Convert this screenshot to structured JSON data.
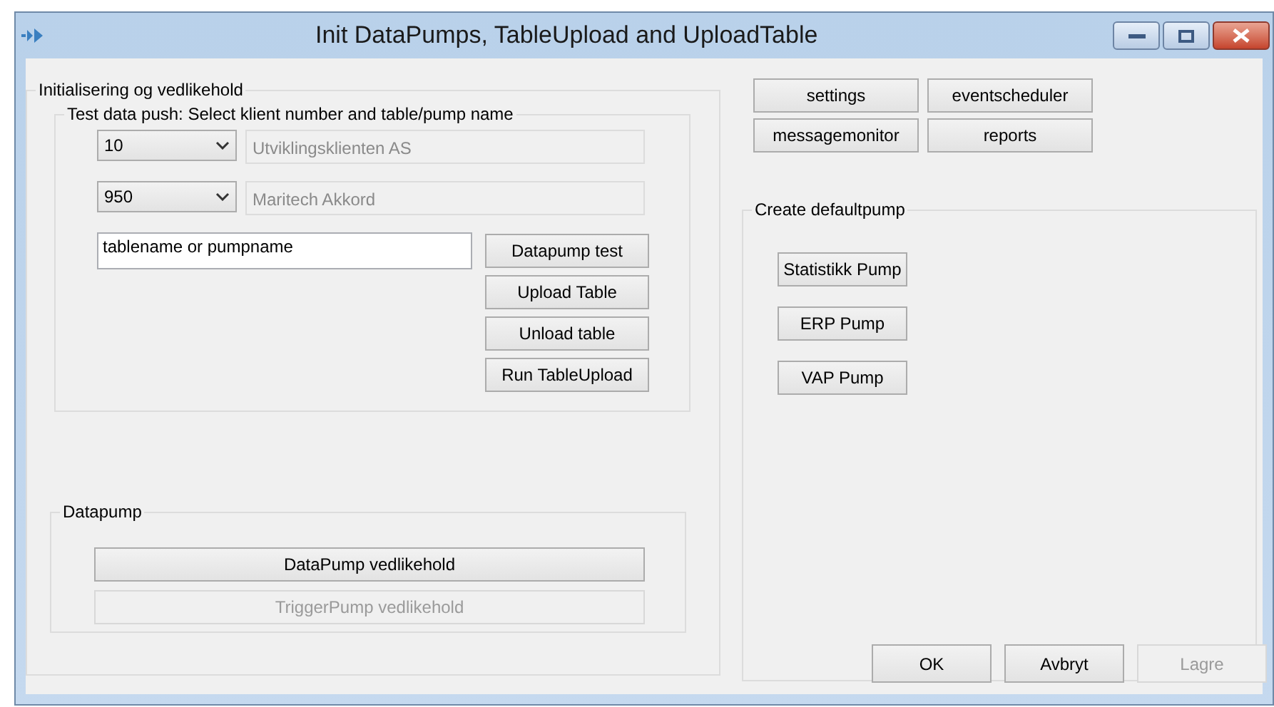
{
  "window": {
    "title": "Init DataPumps, TableUpload and UploadTable"
  },
  "init_group": {
    "title": "Initialisering og vedlikehold",
    "test_group": {
      "title": "Test data push: Select klient number and table/pump name",
      "combos": [
        {
          "value": "10",
          "name": "Utviklingsklienten AS"
        },
        {
          "value": "950",
          "name": "Maritech Akkord"
        }
      ],
      "name_field": {
        "value": "tablename or pumpname"
      },
      "buttons": [
        {
          "label": "Datapump test",
          "disabled": false
        },
        {
          "label": "Upload Table",
          "disabled": false
        },
        {
          "label": "Unload table",
          "disabled": false
        },
        {
          "label": "Run TableUpload",
          "disabled": false
        }
      ]
    },
    "datapump_group": {
      "title": "Datapump",
      "buttons": [
        {
          "label": "DataPump vedlikehold",
          "disabled": false
        },
        {
          "label": "TriggerPump vedlikehold",
          "disabled": true
        }
      ]
    }
  },
  "top_buttons": [
    {
      "label": "settings",
      "disabled": false
    },
    {
      "label": "eventscheduler",
      "disabled": false
    },
    {
      "label": "messagemonitor",
      "disabled": false
    },
    {
      "label": "reports",
      "disabled": false
    }
  ],
  "defaultpump_group": {
    "title": "Create defaultpump",
    "buttons": [
      {
        "label": "Statistikk Pump",
        "disabled": false
      },
      {
        "label": "ERP Pump",
        "disabled": false
      },
      {
        "label": "VAP Pump",
        "disabled": false
      }
    ]
  },
  "dialog_buttons": [
    {
      "label": "OK",
      "disabled": false
    },
    {
      "label": "Avbryt",
      "disabled": false
    },
    {
      "label": "Lagre",
      "disabled": true
    }
  ]
}
